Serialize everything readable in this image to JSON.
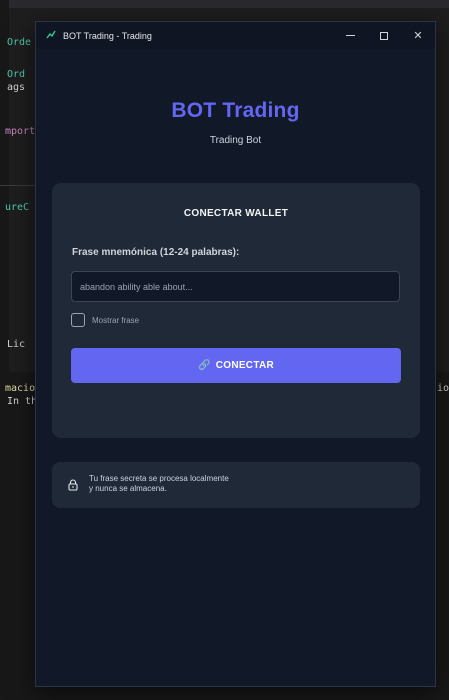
{
  "background_editor": {
    "lines": [
      {
        "text": "Orde",
        "color": "green"
      },
      {
        "text": " Ord",
        "color": "green"
      },
      {
        "text": "ags",
        "color": "white"
      },
      {
        "text": "mport",
        "color": "pink"
      },
      {
        "text": "ureC",
        "color": "green"
      },
      {
        "text": " Lic",
        "color": "white"
      },
      {
        "text": "macio",
        "color": "yellow"
      },
      {
        "text": "In th",
        "color": "white"
      },
      {
        "text": "io",
        "color": "white"
      }
    ]
  },
  "window": {
    "title": "BOT Trading - Trading",
    "app_icon": "chart-icon",
    "controls": {
      "minimize": "minimize-icon",
      "maximize": "maximize-icon",
      "close": "✕"
    }
  },
  "header": {
    "title": "BOT Trading",
    "subtitle": "Trading Bot"
  },
  "wallet_card": {
    "title": "CONECTAR WALLET",
    "mnemonic_label": "Frase mnemónica (12-24 palabras):",
    "mnemonic_placeholder": "abandon ability able about...",
    "mnemonic_value": "",
    "show_phrase_label": "Mostrar frase",
    "show_phrase_checked": false,
    "connect_icon": "🔗",
    "connect_label": "CONECTAR"
  },
  "notice": {
    "icon": "lock-icon",
    "line1": "Tu frase secreta se procesa localmente",
    "line2": "y nunca se almacena."
  },
  "colors": {
    "accent": "#6366f1",
    "window_bg": "#111827",
    "card_bg": "#1f2937"
  }
}
